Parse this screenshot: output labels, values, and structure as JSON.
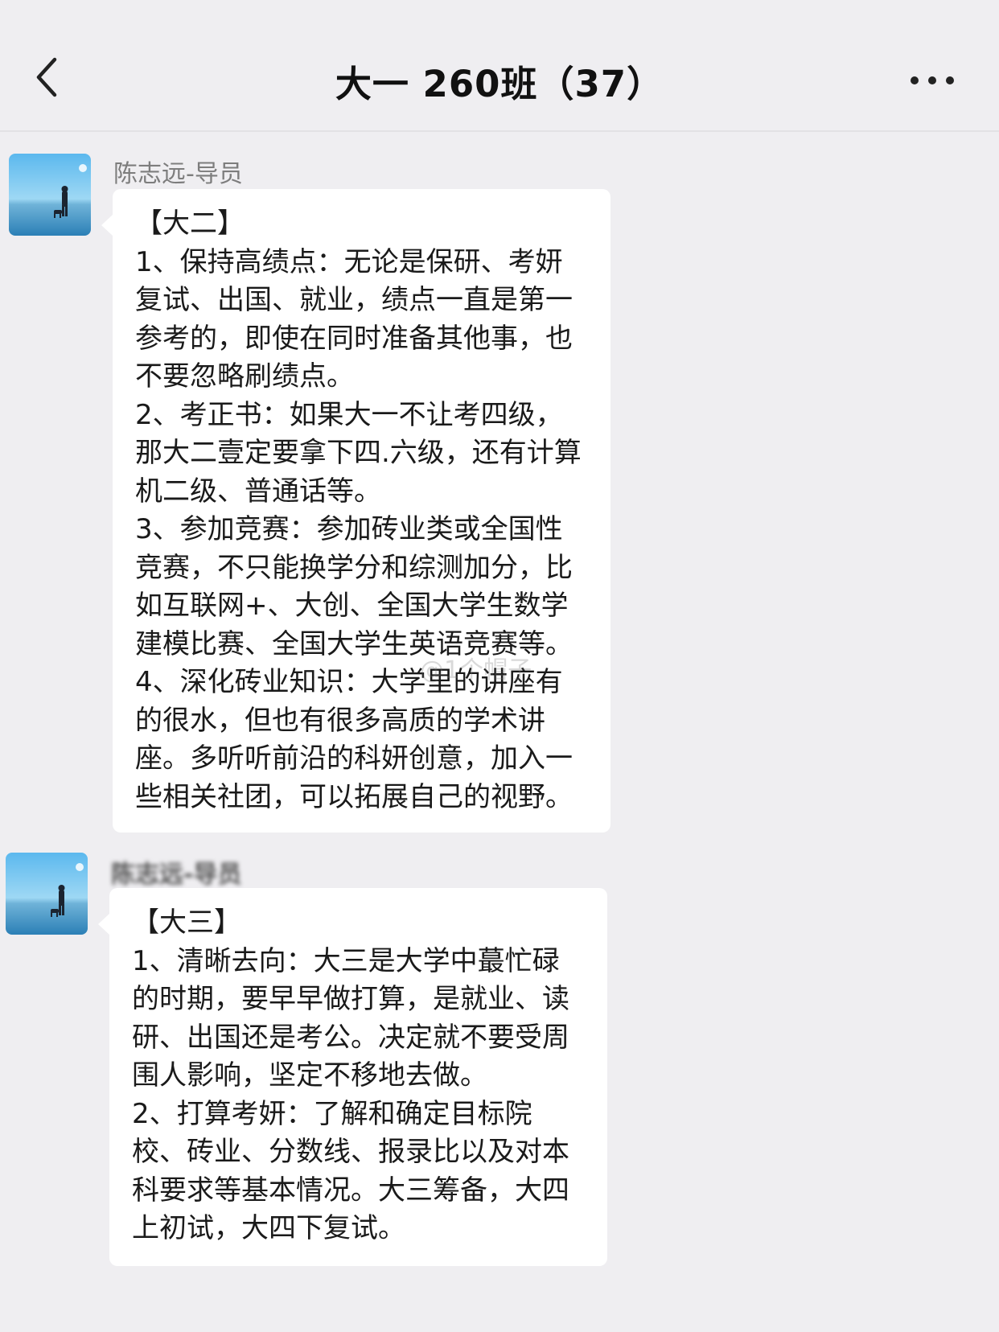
{
  "header": {
    "title": "大一 260班（37）",
    "back_icon": "chevron-left-icon",
    "more_icon": "ellipsis-icon"
  },
  "messages": [
    {
      "sender": "陈志远-导员",
      "text": "【大二】\n1、保持高绩点：无论是保研、考妍复试、出国、就业，绩点一直是第一参考的，即使在同时准备其他事，也不要忽略刷绩点。\n2、考正书：如果大一不让考四级，那大二壹定要拿下四.六级，还有计算机二级、普通话等。\n3、参加竞赛：参加砖业类或全国性竞赛，不只能换学分和综测加分，比如互联网+、大创、全国大学生数学建模比赛、全国大学生英语竞赛等。\n4、深化砖业知识：大学里的讲座有的很水，但也有很多高质的学术讲座。多听听前沿的科妍创意，加入一些相关社团，可以拓展自己的视野。"
    },
    {
      "sender": "陈志远-导员",
      "text": "【大三】\n1、清晰去向：大三是大学中蕞忙碌的时期，要早早做打算，是就业、读研、出国还是考公。决定就不要受周围人影响，坚定不移地去做。\n2、打算考妍：了解和确定目标院校、砖业、分数线、报录比以及对本科要求等基本情况。大三筹备，大四上初试，大四下复试。"
    }
  ],
  "watermark": "@1个帽子",
  "colors": {
    "background": "#EFEEF1",
    "bubble": "#FFFFFF",
    "text": "#1A1A1A",
    "sender": "#7D7D7D"
  }
}
